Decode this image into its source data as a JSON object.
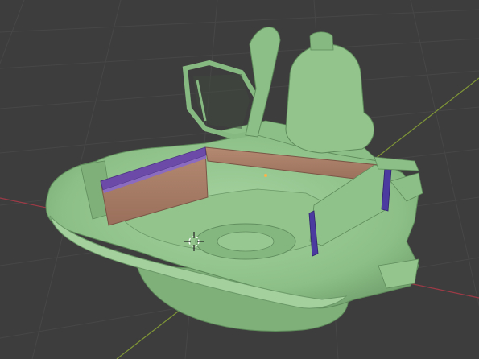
{
  "viewport": {
    "background": "#3d3d3d",
    "grid_color": "#4a4a4a",
    "x_axis_color": "#b0414f",
    "y_axis_color": "#8fa83c"
  },
  "scene": {
    "model_color": "#8fc28a",
    "model_shade": "#6e9f6b",
    "model_highlight": "#a9d6a3",
    "panel_wood_color": "#a77a64",
    "panel_purple_color": "#6a4ca6",
    "panel_blue_color": "#4a3aa0"
  },
  "icons": {
    "origin": "3d-cursor-icon"
  }
}
